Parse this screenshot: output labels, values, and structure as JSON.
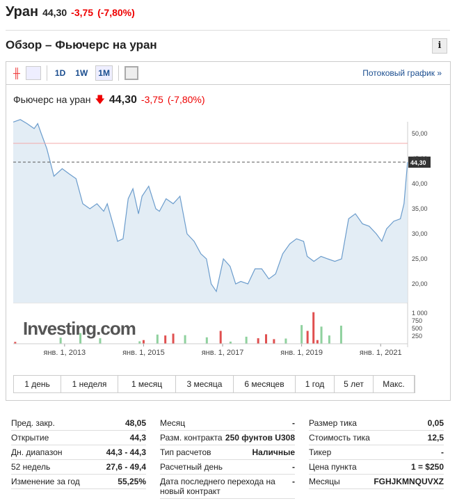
{
  "header": {
    "name": "Уран",
    "price": "44,30",
    "change": "-3,75",
    "pct": "(-7,80%)"
  },
  "section_title": "Обзор – Фьючерс на уран",
  "info_label": "i",
  "toolbar": {
    "tf": [
      "1D",
      "1W",
      "1M"
    ],
    "active": "1M",
    "stream": "Потоковый график »"
  },
  "chart_header": {
    "name": "Фьючерс на уран",
    "price": "44,30",
    "change": "-3,75",
    "pct": "(-7,80%)"
  },
  "ranges": [
    "1 день",
    "1 неделя",
    "1 месяц",
    "3 месяца",
    "6 месяцев",
    "1 год",
    "5 лет",
    "Макс."
  ],
  "watermark": "Investing.com",
  "chart_data": {
    "type": "line",
    "ylim": [
      17,
      53
    ],
    "y_ticks": [
      "50,00",
      "45,00",
      "40,00",
      "35,00",
      "30,00",
      "25,00",
      "20,00"
    ],
    "y_tick_values": [
      50,
      45,
      40,
      35,
      30,
      25,
      20
    ],
    "x_ticks": [
      "янв. 1, 2013",
      "янв. 1, 2015",
      "янв. 1, 2017",
      "янв. 1, 2019",
      "янв. 1, 2021"
    ],
    "x_tick_values": [
      2013,
      2015,
      2017,
      2019,
      2021
    ],
    "last_label": "44,30",
    "prev_close": 48.05,
    "last": 44.3,
    "x": [
      2011.7,
      2011.88,
      2012.05,
      2012.23,
      2012.32,
      2012.41,
      2012.55,
      2012.73,
      2012.94,
      2013.11,
      2013.29,
      2013.46,
      2013.64,
      2013.82,
      2013.99,
      2014.08,
      2014.26,
      2014.34,
      2014.48,
      2014.61,
      2014.73,
      2014.87,
      2014.96,
      2015.13,
      2015.31,
      2015.4,
      2015.57,
      2015.75,
      2015.92,
      2016.1,
      2016.28,
      2016.45,
      2016.59,
      2016.71,
      2016.84,
      2017.02,
      2017.19,
      2017.33,
      2017.46,
      2017.64,
      2017.82,
      2017.99,
      2018.17,
      2018.34,
      2018.52,
      2018.7,
      2018.87,
      2019.05,
      2019.14,
      2019.31,
      2019.49,
      2019.66,
      2019.84,
      2020.01,
      2020.19,
      2020.36,
      2020.54,
      2020.71,
      2020.89,
      2021.03,
      2021.15,
      2021.33,
      2021.5,
      2021.59,
      2021.68
    ],
    "y": [
      52.3,
      52.8,
      52,
      51,
      52,
      50,
      47,
      41.5,
      43,
      42,
      41,
      36,
      35,
      36,
      34.5,
      36,
      31,
      28.5,
      29,
      37,
      39,
      34,
      37.5,
      39.5,
      35,
      34.5,
      37,
      36,
      37.5,
      30,
      28.5,
      26,
      25,
      20,
      18.5,
      25,
      23.5,
      20,
      20.5,
      20,
      23,
      23,
      21,
      22,
      26,
      28,
      29,
      28.5,
      25.5,
      24.5,
      25.5,
      25,
      24.5,
      25,
      33,
      34,
      32,
      31.5,
      30,
      28.5,
      31,
      32.5,
      33,
      36,
      44.3
    ],
    "volume_ticks": [
      "1 000",
      "750",
      "500",
      "250"
    ],
    "volume": [
      [
        2011.75,
        60,
        "r"
      ],
      [
        2012.9,
        200,
        "g"
      ],
      [
        2013.4,
        350,
        "g"
      ],
      [
        2013.9,
        180,
        "g"
      ],
      [
        2014.9,
        80,
        "g"
      ],
      [
        2015.0,
        120,
        "r"
      ],
      [
        2015.35,
        300,
        "g"
      ],
      [
        2015.55,
        270,
        "r"
      ],
      [
        2015.75,
        330,
        "r"
      ],
      [
        2016.05,
        280,
        "g"
      ],
      [
        2016.6,
        210,
        "g"
      ],
      [
        2016.95,
        420,
        "r"
      ],
      [
        2017.2,
        70,
        "g"
      ],
      [
        2017.6,
        230,
        "g"
      ],
      [
        2017.9,
        180,
        "r"
      ],
      [
        2018.1,
        310,
        "r"
      ],
      [
        2018.3,
        150,
        "r"
      ],
      [
        2018.6,
        170,
        "g"
      ],
      [
        2019.0,
        610,
        "g"
      ],
      [
        2019.15,
        420,
        "r"
      ],
      [
        2019.3,
        1030,
        "r"
      ],
      [
        2019.4,
        120,
        "r"
      ],
      [
        2019.5,
        560,
        "g"
      ],
      [
        2019.7,
        270,
        "g"
      ],
      [
        2020.0,
        590,
        "g"
      ]
    ]
  },
  "stats": [
    [
      [
        "Пред. закр.",
        "48,05"
      ],
      [
        "Открытие",
        "44,3"
      ],
      [
        "Дн. диапазон",
        "44,3 - 44,3"
      ],
      [
        "52 недель",
        "27,6 - 49,4"
      ],
      [
        "Изменение за год",
        "55,25%"
      ]
    ],
    [
      [
        "Месяц",
        "-"
      ],
      [
        "Разм. контракта",
        "250 фунтов U308"
      ],
      [
        "Тип расчетов",
        "Наличные"
      ],
      [
        "Расчетный день",
        "-"
      ],
      [
        "Дата последнего перехода на новый контракт",
        "-"
      ]
    ],
    [
      [
        "Размер тика",
        "0,05"
      ],
      [
        "Стоимость тика",
        "12,5"
      ],
      [
        "Тикер",
        "-"
      ],
      [
        "Цена пункта",
        "1 = $250"
      ],
      [
        "Месяцы",
        "FGHJKMNQUVXZ"
      ]
    ]
  ]
}
